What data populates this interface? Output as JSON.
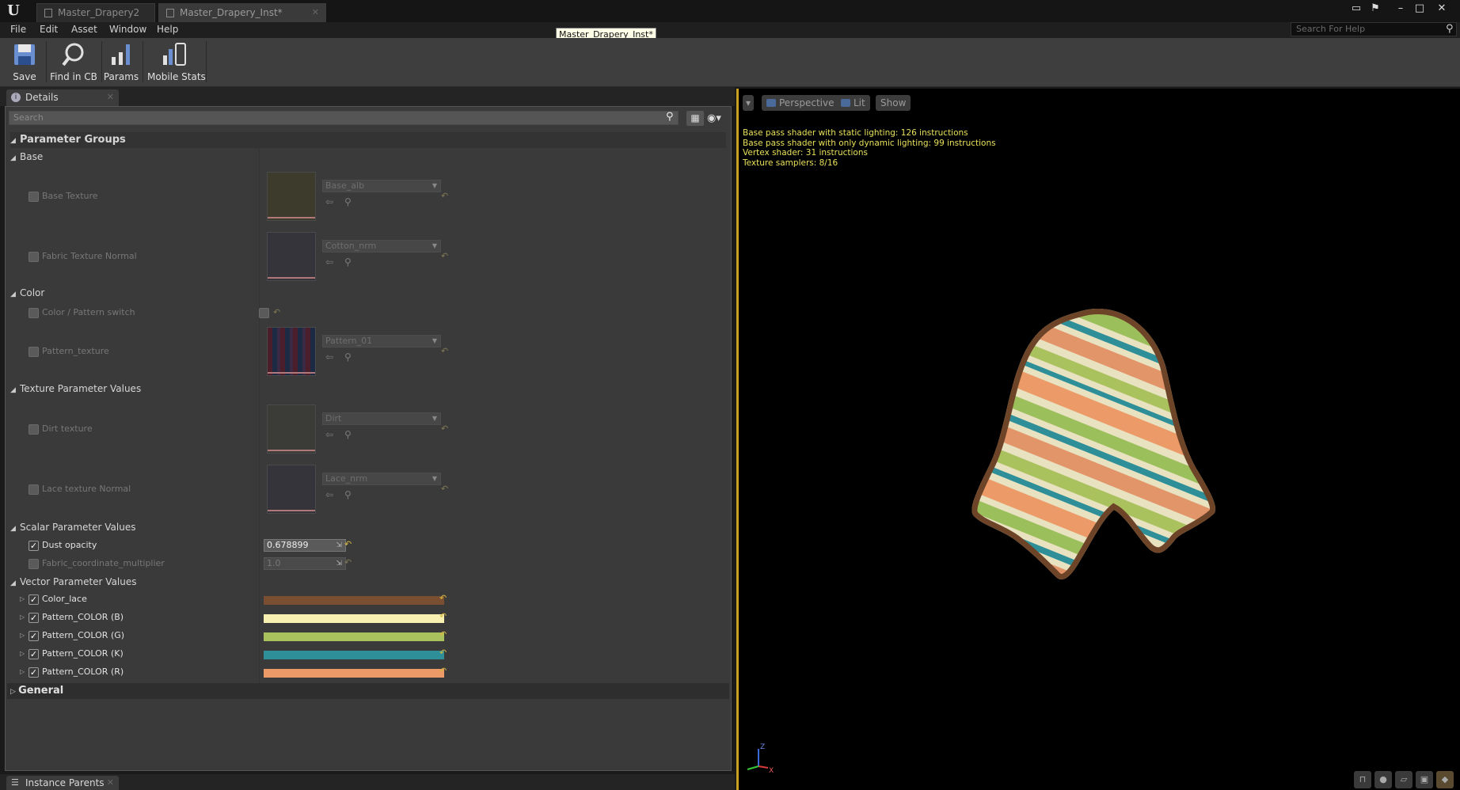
{
  "titlebar": {
    "tabs": [
      {
        "label": "Master_Drapery2"
      },
      {
        "label": "Master_Drapery_Inst*"
      }
    ],
    "tooltip": "Master_Drapery_Inst*"
  },
  "menu": {
    "items": [
      "File",
      "Edit",
      "Asset",
      "Window",
      "Help"
    ],
    "help_search_placeholder": "Search For Help"
  },
  "toolbar": {
    "buttons": [
      {
        "label": "Save",
        "icon": "save-icon"
      },
      {
        "label": "Find in CB",
        "icon": "magnifier-icon"
      },
      {
        "label": "Params",
        "icon": "bars-icon"
      },
      {
        "label": "Mobile Stats",
        "icon": "stats-icon"
      }
    ]
  },
  "details": {
    "tab_label": "Details",
    "search_placeholder": "Search",
    "parameter_groups_label": "Parameter Groups",
    "groups": {
      "base": {
        "label": "Base",
        "params": [
          {
            "label": "Base Texture",
            "asset": "Base_alb"
          },
          {
            "label": "Fabric Texture Normal",
            "asset": "Cotton_nrm"
          }
        ]
      },
      "color": {
        "label": "Color",
        "params": [
          {
            "label": "Color / Pattern switch"
          },
          {
            "label": "Pattern_texture",
            "asset": "Pattern_01"
          }
        ]
      },
      "texture": {
        "label": "Texture Parameter Values",
        "params": [
          {
            "label": "Dirt texture",
            "asset": "Dirt"
          },
          {
            "label": "Lace texture Normal",
            "asset": "Lace_nrm"
          }
        ]
      },
      "scalar": {
        "label": "Scalar Parameter Values",
        "params": [
          {
            "label": "Dust opacity",
            "value": "0.678899",
            "enabled": true
          },
          {
            "label": "Fabric_coordinate_multiplier",
            "value": "1.0",
            "enabled": false
          }
        ]
      },
      "vector": {
        "label": "Vector Parameter Values",
        "params": [
          {
            "label": "Color_lace",
            "color": "#7a4e30"
          },
          {
            "label": "Pattern_COLOR (B)",
            "color": "#f7f0b0"
          },
          {
            "label": "Pattern_COLOR (G)",
            "color": "#a9c25e"
          },
          {
            "label": "Pattern_COLOR (K)",
            "color": "#2f8f98"
          },
          {
            "label": "Pattern_COLOR (R)",
            "color": "#eb9a68"
          }
        ]
      }
    },
    "general_label": "General"
  },
  "bottom_tab": {
    "label": "Instance Parents"
  },
  "viewport": {
    "buttons": [
      "Perspective",
      "Lit",
      "Show"
    ],
    "stats": [
      "Base pass shader with static lighting: 126 instructions",
      "Base pass shader with only dynamic lighting: 99 instructions",
      "Vertex shader: 31 instructions",
      "Texture samplers: 8/16"
    ],
    "axis": {
      "z": "Z",
      "x": "X"
    }
  },
  "colors": {
    "accent_yellow": "#c8a020",
    "stats_text": "#e8e05a"
  }
}
